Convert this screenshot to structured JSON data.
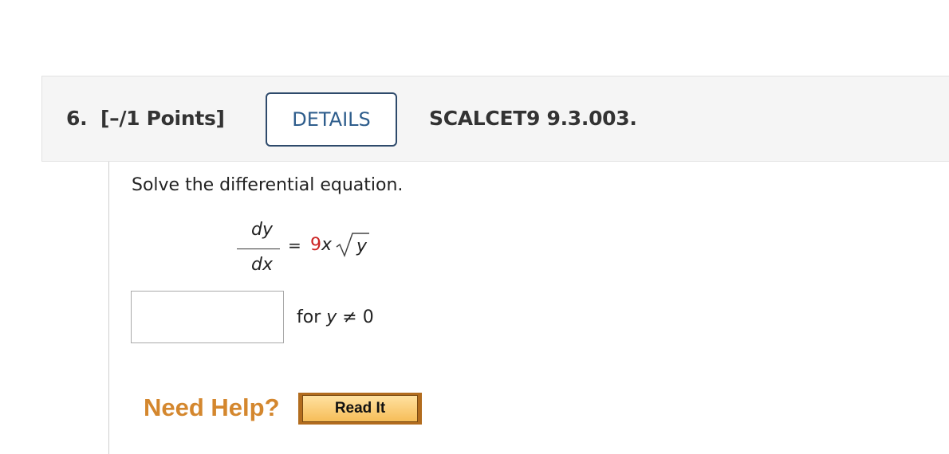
{
  "question": {
    "number": "6.",
    "points": "[–/1 Points]",
    "details_label": "DETAILS",
    "code": "SCALCET9 9.3.003."
  },
  "problem": {
    "prompt": "Solve the differential equation.",
    "equation": {
      "numerator": "dy",
      "denominator": "dx",
      "equals": "=",
      "coefficient": "9",
      "x_var": "x",
      "radicand": "y",
      "coefficient_color": "#cc2222"
    },
    "answer_value": "",
    "condition": {
      "prefix": "for ",
      "var": "y",
      "rest": " ≠ 0"
    }
  },
  "help": {
    "label": "Need Help?",
    "read_it_label": "Read It"
  }
}
